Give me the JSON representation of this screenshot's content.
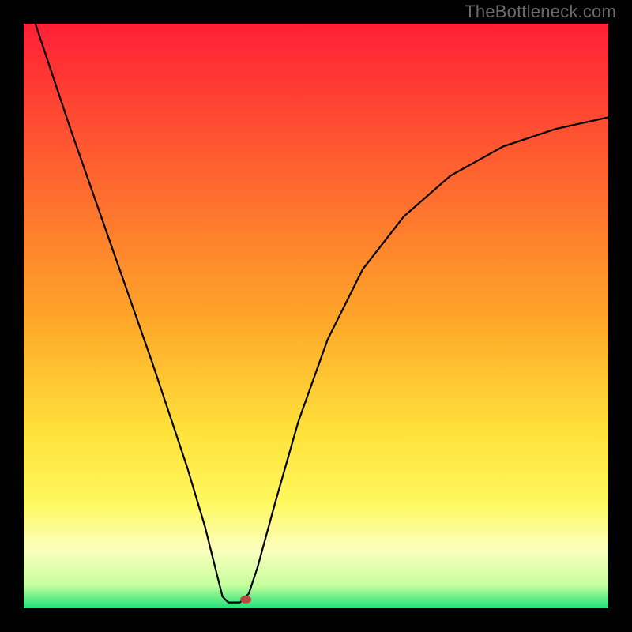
{
  "watermark": "TheBottleneck.com",
  "chart_data": {
    "type": "line",
    "title": "",
    "xlabel": "",
    "ylabel": "",
    "xlim": [
      0,
      100
    ],
    "ylim": [
      0,
      100
    ],
    "gradient_stops": [
      {
        "offset": 0,
        "color": "#ff1f36"
      },
      {
        "offset": 0.5,
        "color": "#ffa529"
      },
      {
        "offset": 0.7,
        "color": "#ffe23a"
      },
      {
        "offset": 0.82,
        "color": "#fff85f"
      },
      {
        "offset": 0.9,
        "color": "#fbffbe"
      },
      {
        "offset": 0.96,
        "color": "#c7ff9e"
      },
      {
        "offset": 1.0,
        "color": "#1fe07a"
      }
    ],
    "curve": [
      {
        "x": 2,
        "y": 100
      },
      {
        "x": 8,
        "y": 82
      },
      {
        "x": 15,
        "y": 62
      },
      {
        "x": 22,
        "y": 42
      },
      {
        "x": 28,
        "y": 24
      },
      {
        "x": 31,
        "y": 14
      },
      {
        "x": 33,
        "y": 6
      },
      {
        "x": 34,
        "y": 2
      },
      {
        "x": 35,
        "y": 1
      },
      {
        "x": 37,
        "y": 1
      },
      {
        "x": 38.5,
        "y": 2.5
      },
      {
        "x": 40,
        "y": 7
      },
      {
        "x": 43,
        "y": 18
      },
      {
        "x": 47,
        "y": 32
      },
      {
        "x": 52,
        "y": 46
      },
      {
        "x": 58,
        "y": 58
      },
      {
        "x": 65,
        "y": 67
      },
      {
        "x": 73,
        "y": 74
      },
      {
        "x": 82,
        "y": 79
      },
      {
        "x": 91,
        "y": 82
      },
      {
        "x": 100,
        "y": 84
      }
    ],
    "marker": {
      "x": 38,
      "y": 1.5,
      "rx": 7,
      "ry": 5
    }
  }
}
